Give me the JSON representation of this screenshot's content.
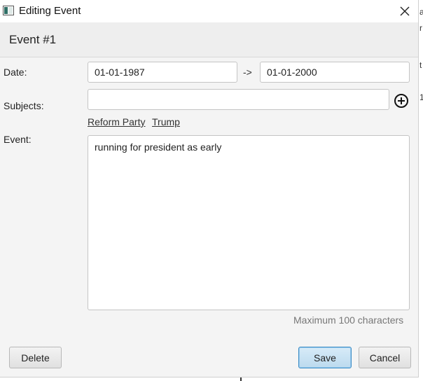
{
  "window": {
    "title": "Editing Event"
  },
  "header": {
    "title": "Event #1"
  },
  "form": {
    "date_label": "Date:",
    "date_from": "01-01-1987",
    "date_separator": "->",
    "date_to": "01-01-2000",
    "subjects_label": "Subjects:",
    "subjects_value": "",
    "subjects": [
      "Reform Party",
      "Trump"
    ],
    "event_label": "Event:",
    "event_text": "running for president as early",
    "hint": "Maximum 100 characters"
  },
  "buttons": {
    "delete": "Delete",
    "save": "Save",
    "cancel": "Cancel"
  },
  "background": {
    "chars": [
      "a",
      "r",
      "t",
      "1"
    ]
  },
  "icons": {
    "close": "close-icon",
    "add": "add-circle-icon",
    "app": "window-icon"
  },
  "colors": {
    "primary_border": "#3c8dc5",
    "hint": "#777777"
  }
}
